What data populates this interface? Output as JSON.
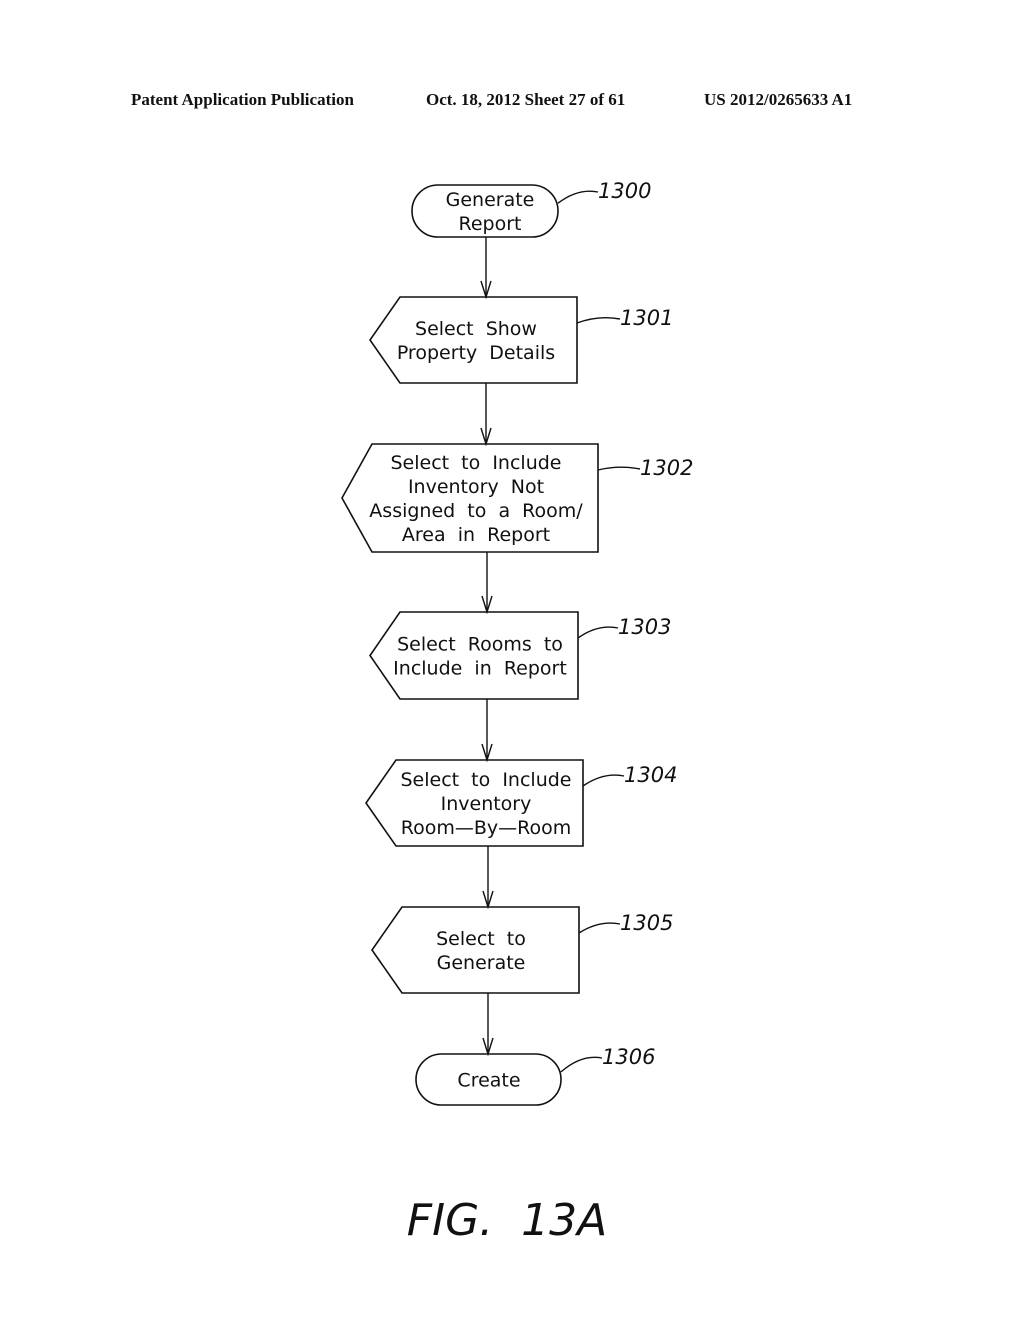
{
  "header": {
    "publication": "Patent Application Publication",
    "date_sheet": "Oct. 18, 2012   Sheet 27 of 61",
    "patent_number": "US 2012/0265633 A1"
  },
  "diagram": {
    "nodes": [
      {
        "id": "1300",
        "shape": "terminal",
        "lines": [
          "Generate",
          "Report"
        ],
        "ref": "1300"
      },
      {
        "id": "1301",
        "shape": "display",
        "lines": [
          "Select  Show",
          "Property  Details"
        ],
        "ref": "1301"
      },
      {
        "id": "1302",
        "shape": "display",
        "lines": [
          "Select  to  Include",
          "Inventory  Not",
          "Assigned  to  a  Room/",
          "Area  in  Report"
        ],
        "ref": "1302"
      },
      {
        "id": "1303",
        "shape": "display",
        "lines": [
          "Select  Rooms  to",
          "Include  in  Report"
        ],
        "ref": "1303"
      },
      {
        "id": "1304",
        "shape": "display",
        "lines": [
          "Select  to  Include",
          "Inventory",
          "Room—By—Room"
        ],
        "ref": "1304"
      },
      {
        "id": "1305",
        "shape": "display",
        "lines": [
          "Select  to",
          "Generate"
        ],
        "ref": "1305"
      },
      {
        "id": "1306",
        "shape": "terminal",
        "lines": [
          "Create"
        ],
        "ref": "1306"
      }
    ],
    "edges": [
      {
        "from": "1300",
        "to": "1301"
      },
      {
        "from": "1301",
        "to": "1302"
      },
      {
        "from": "1302",
        "to": "1303"
      },
      {
        "from": "1303",
        "to": "1304"
      },
      {
        "from": "1304",
        "to": "1305"
      },
      {
        "from": "1305",
        "to": "1306"
      }
    ],
    "figure_label": "FIG.  13A"
  }
}
